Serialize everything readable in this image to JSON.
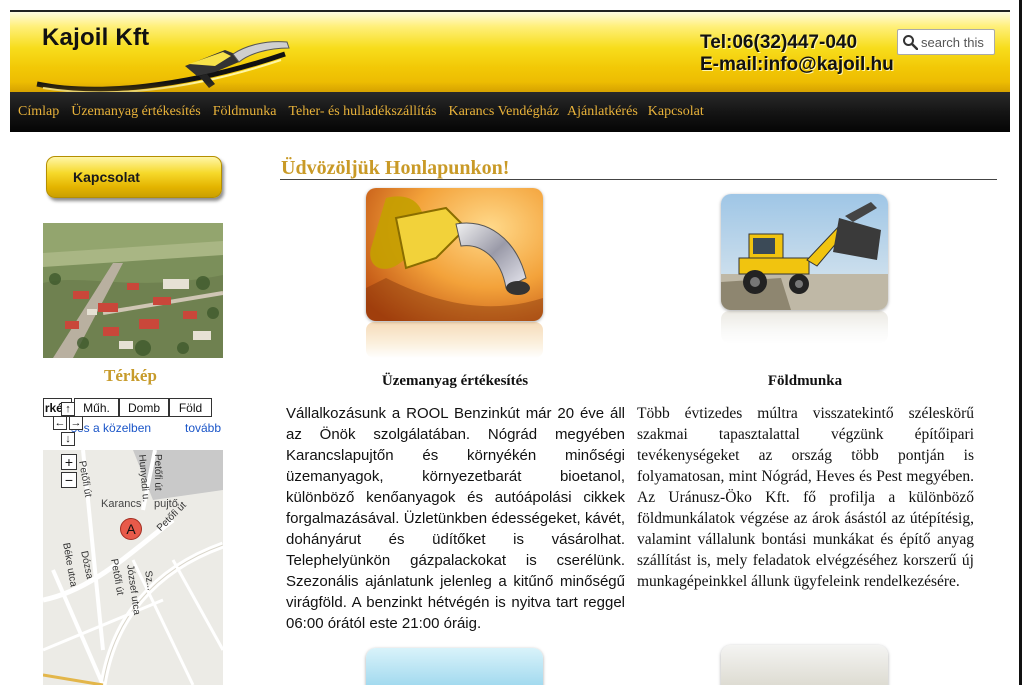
{
  "header": {
    "logo_text": "Kajoil Kft",
    "phone": "Tel:06(32)447-040",
    "email": "E-mail:info@kajoil.hu",
    "search_placeholder": "search this"
  },
  "nav": {
    "items": [
      {
        "label": "Címlap"
      },
      {
        "label": "Üzemanyag értékesítés"
      },
      {
        "label": "Földmunka"
      },
      {
        "label": "Teher- és hulladékszállítás"
      },
      {
        "label": "Karancs Vendégház"
      },
      {
        "label": "Ajánlatkérés"
      },
      {
        "label": "Kapcsolat"
      }
    ]
  },
  "sidebar": {
    "contact_button": "Kapcsolat",
    "map_title": "Térkép",
    "map": {
      "tabs": [
        "rkép",
        "Műh.",
        "Domb",
        "Föld"
      ],
      "link_search": "ses a közelben",
      "link_more": "tovább",
      "marker_letter": "A",
      "town_label": "Karancs",
      "town_label_rest": "pujtő",
      "streets": [
        "Petőfi út",
        "Petőfi út",
        "Hunyadi u.",
        "Petőfi út",
        "Béke utca",
        "Dózsa",
        "József utca",
        "Sz...",
        "Petőfi út"
      ]
    }
  },
  "main": {
    "title": "Üdvözöljük Honlapunkon!",
    "col1": {
      "heading": "Üzemanyag értékesítés",
      "text": "Vállalkozásunk a ROOL Benzinkút már 20 éve áll az Önök szolgálatában. Nógrád megyében Karancslapujtőn és környékén minőségi üzemanyagok, környezetbarát bioetanol, különböző kenőanyagok és autóápolási cikkek forgalmazásával. Üzletünkben édességeket, kávét, dohányárut és üdítőket is vásárolhat. Telephelyünkön gázpalackokat is cserélünk. Szezonális ajánlatunk jelenleg a kitűnő minőségű virágföld. A benzinkt hétvégén is nyitva tart reggel 06:00 órától este 21:00 óráig."
    },
    "col2": {
      "heading": "Földmunka",
      "text": "Több évtizedes múltra visszatekintő széleskörű szakmai tapasztalattal végzünk építőipari tevékenységeket az ország több pontján is folyamatosan, mint Nógrád, Heves és Pest megyében. Az Uránusz-Öko Kft. fő profilja a különböző földmunkálatok végzése az árok ásástól az útépítésig, valamint vállalunk bontási munkákat és építő anyag szállítást is, mely feladatok elvégzéséhez korszerű új munkagépeinkkel állunk ügyfeleink rendelkezésére."
    }
  },
  "colors": {
    "accent_gold": "#c99a27",
    "nav_text": "#e8b23a",
    "header_yellow": "#f2c806",
    "nav_bg": "#111111"
  }
}
